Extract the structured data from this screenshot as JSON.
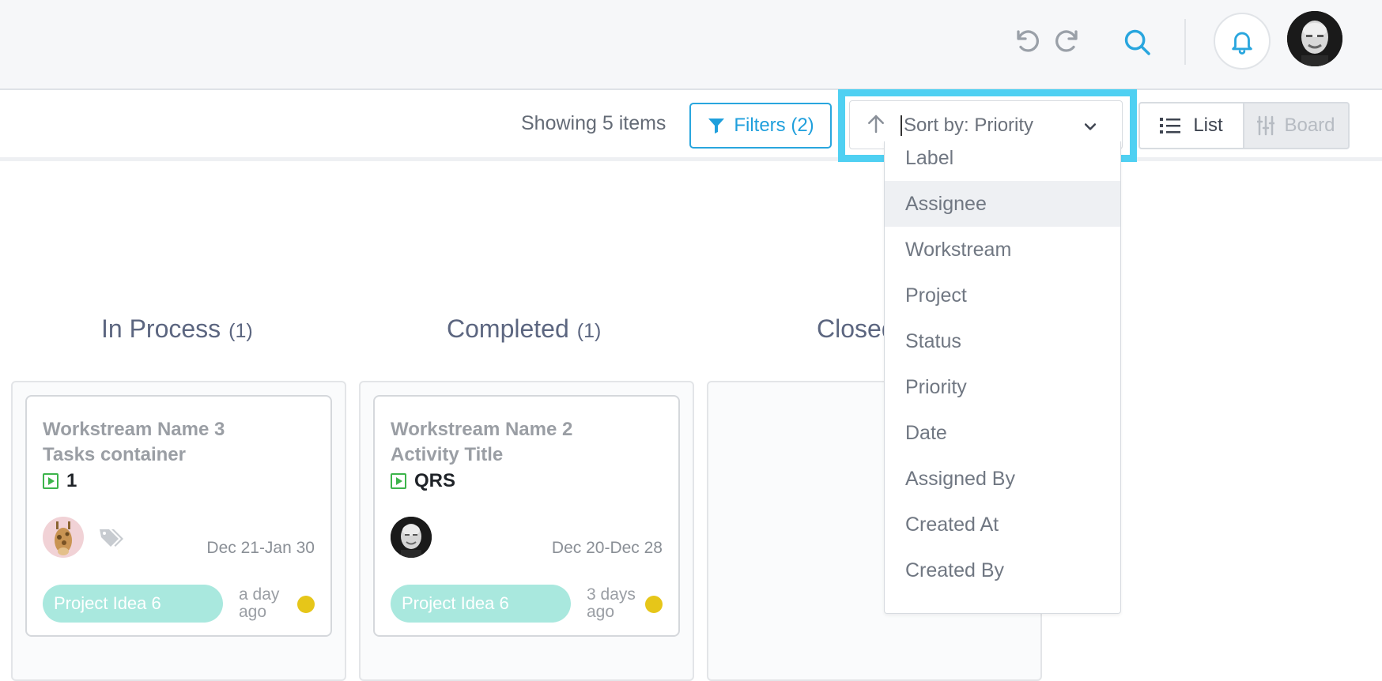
{
  "header": {
    "undo_icon": "undo-icon",
    "redo_icon": "redo-icon",
    "search_icon": "search-icon",
    "bell_icon": "bell-icon",
    "accent_color": "#29a6de"
  },
  "toolbar": {
    "showing_text": "Showing 5 items",
    "filters_label": "Filters (2)",
    "sort_label": "Sort by: Priority",
    "list_label": "List",
    "board_label": "Board",
    "highlight_color": "#4fd0f2"
  },
  "sort_dropdown": {
    "items": [
      "Label",
      "Assignee",
      "Workstream",
      "Project",
      "Status",
      "Priority",
      "Date",
      "Assigned By",
      "Created At",
      "Created By"
    ],
    "hovered": "Assignee"
  },
  "columns": [
    {
      "title": "In Process",
      "count": "(1)"
    },
    {
      "title": "Completed",
      "count": "(1)"
    },
    {
      "title": "Closed",
      "count": ""
    }
  ],
  "cards": [
    {
      "line1": "Workstream Name 3",
      "line2": "Tasks container",
      "code": "1",
      "date": "Dec 21-Jan 30",
      "tag": "Project Idea 6",
      "ago_line1": "a day",
      "ago_line2": "ago",
      "dot_color": "#e6c619"
    },
    {
      "line1": "Workstream Name 2",
      "line2": "Activity Title",
      "code": "QRS",
      "date": "Dec 20-Dec 28",
      "tag": "Project Idea 6",
      "ago_line1": "3 days",
      "ago_line2": "ago",
      "dot_color": "#e6c619"
    }
  ]
}
